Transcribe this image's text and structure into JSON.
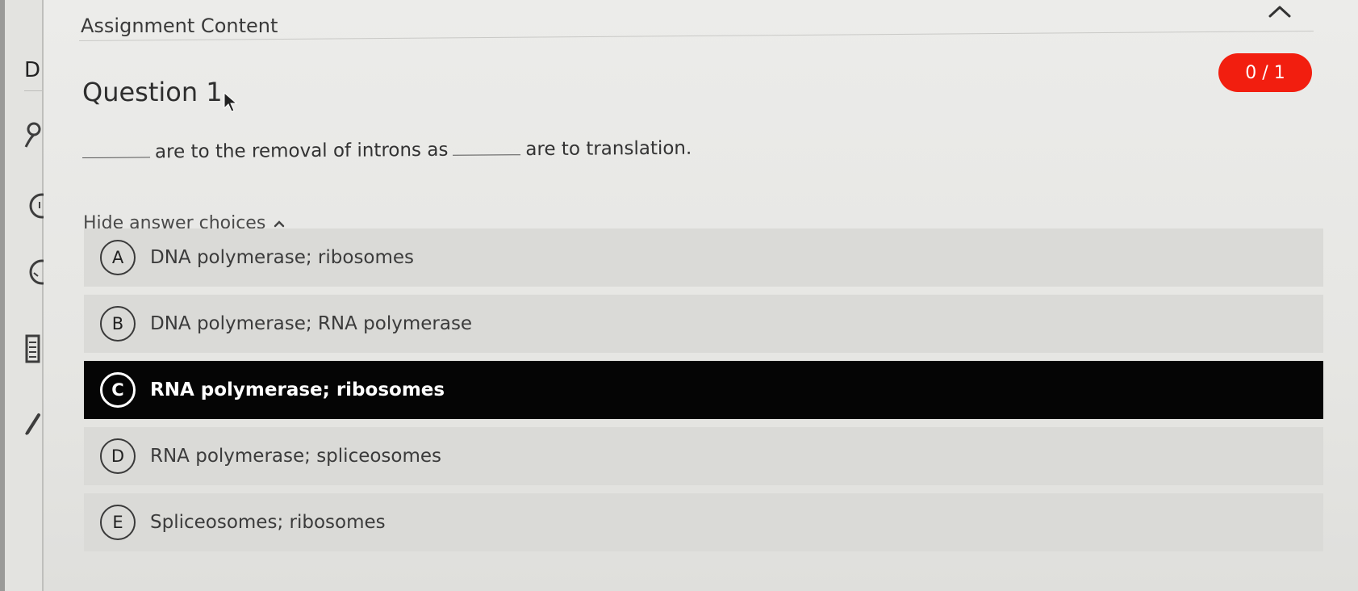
{
  "header": {
    "title": "Assignment Content"
  },
  "left_rail": {
    "letter": "D"
  },
  "question": {
    "title": "Question 1",
    "score": "0 / 1",
    "stem_middle": "are to the removal of introns as",
    "stem_end": "are to translation."
  },
  "toggle": {
    "label": "Hide answer choices"
  },
  "choices": [
    {
      "letter": "A",
      "text": "DNA polymerase; ribosomes"
    },
    {
      "letter": "B",
      "text": "DNA polymerase; RNA polymerase"
    },
    {
      "letter": "C",
      "text": "RNA polymerase; ribosomes",
      "selected": true
    },
    {
      "letter": "D",
      "text": "RNA polymerase; spliceosomes"
    },
    {
      "letter": "E",
      "text": "Spliceosomes; ribosomes"
    }
  ],
  "colors": {
    "score_badge": "#f21e0f",
    "selected_choice": "#050505",
    "choice_bg": "#dadad7"
  },
  "icons": [
    "chevron-up-icon",
    "user-icon",
    "clock-icon",
    "check-circle-icon",
    "calendar-icon",
    "pencil-icon",
    "mouse-cursor-icon"
  ]
}
